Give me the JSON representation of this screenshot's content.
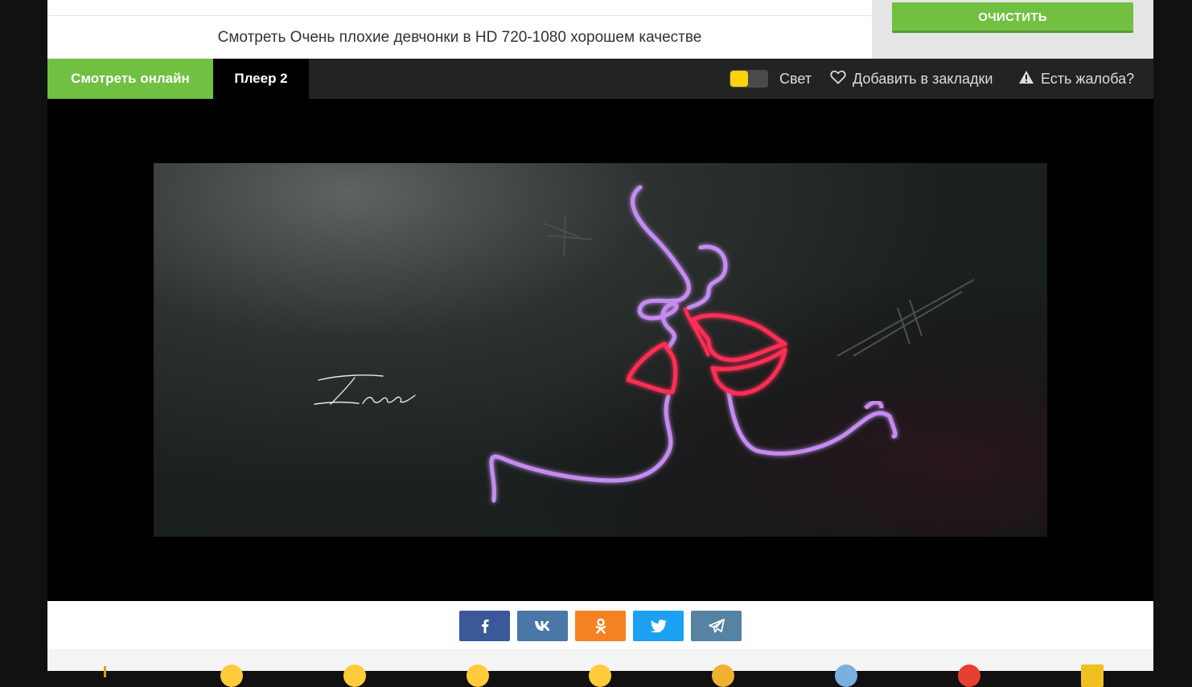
{
  "header": {
    "title": "Смотреть Очень плохие девчонки в HD 720-1080 хорошем качестве",
    "clear_button": "ОЧИСТИТЬ"
  },
  "tabs": [
    {
      "label": "Смотреть онлайн",
      "active": true
    },
    {
      "label": "Плеер 2",
      "active": false
    }
  ],
  "toolbar": {
    "light_label": "Свет",
    "bookmark_label": "Добавить в закладки",
    "report_label": "Есть жалоба?"
  },
  "player": {
    "signature": "Ilana"
  },
  "share": {
    "facebook": "f",
    "vk": "vk",
    "ok": "ok",
    "twitter": "t",
    "telegram": "tg"
  },
  "colors": {
    "accent_green": "#72c042",
    "tabbar_bg": "#232323",
    "facebook": "#3b5998",
    "vk": "#4a76a8",
    "ok": "#f58220",
    "twitter": "#1da1f2",
    "telegram": "#5682a3",
    "toggle_knob": "#ffd20a"
  },
  "icons": {
    "light": "toggle-icon",
    "bookmark": "heart-outline-icon",
    "report": "warning-triangle-icon"
  }
}
